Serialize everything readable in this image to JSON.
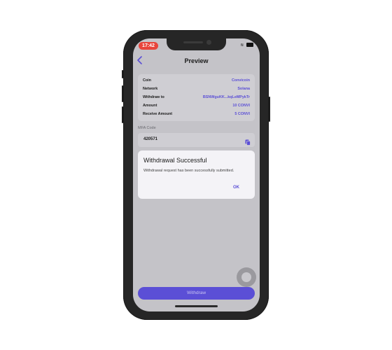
{
  "status_bar": {
    "time": "17:42",
    "battery": "■"
  },
  "header": {
    "title": "Preview",
    "back_icon": "chevron-left-icon"
  },
  "details": [
    {
      "label": "Coin",
      "value": "Convicoin"
    },
    {
      "label": "Network",
      "value": "Solana"
    },
    {
      "label": "Withdraw to",
      "value": "BSNWguKK...kqLeMPykTr"
    },
    {
      "label": "Amount",
      "value": "10 CONVI"
    },
    {
      "label": "Receive Amount",
      "value": "5 CONVI"
    }
  ],
  "mfa": {
    "label": "MFA Code",
    "value": "420571",
    "icon": "paste-icon"
  },
  "dialog": {
    "title": "Withdrawal Successful",
    "message": "Withdrawal request has been successfully submitted.",
    "ok_label": "OK"
  },
  "withdraw_button": {
    "label": "Withdraw"
  },
  "colors": {
    "accent": "#5b4fd6",
    "screen_bg": "#c4c3c8",
    "dialog_bg": "#f4f3f7"
  }
}
